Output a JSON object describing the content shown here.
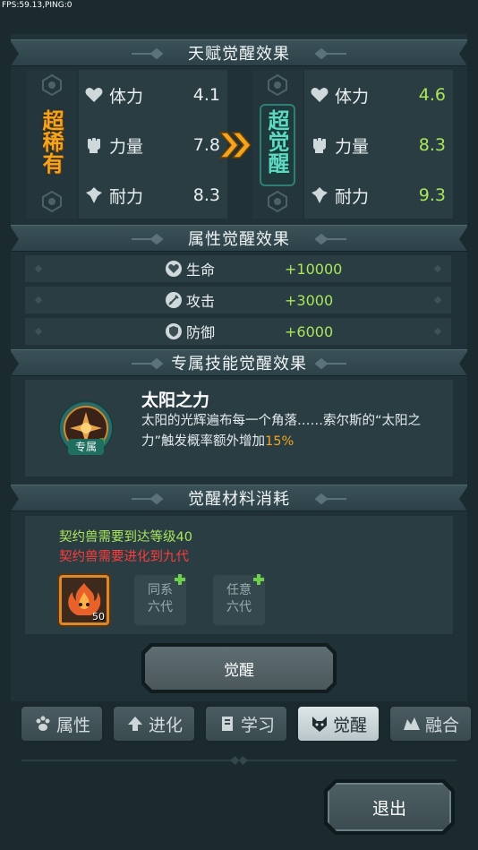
{
  "hud": {
    "fps": "FPS:59.13,PING:0"
  },
  "sections": {
    "talent": "天赋觉醒效果",
    "attr": "属性觉醒效果",
    "skill": "专属技能觉醒效果",
    "material": "觉醒材料消耗"
  },
  "talent": {
    "before": {
      "rank": "超稀有",
      "stats": [
        {
          "name": "体力",
          "value": "4.1",
          "icon": "heart-icon"
        },
        {
          "name": "力量",
          "value": "7.8",
          "icon": "fist-icon"
        },
        {
          "name": "耐力",
          "value": "8.3",
          "icon": "shield-cross-icon"
        }
      ]
    },
    "after": {
      "rank": "超觉醒",
      "stats": [
        {
          "name": "体力",
          "value": "4.6",
          "icon": "heart-icon"
        },
        {
          "name": "力量",
          "value": "8.3",
          "icon": "fist-icon"
        },
        {
          "name": "耐力",
          "value": "9.3",
          "icon": "shield-cross-icon"
        }
      ]
    }
  },
  "attributes": [
    {
      "name": "生命",
      "value": "+10000",
      "icon": "heart-shield-icon"
    },
    {
      "name": "攻击",
      "value": "+3000",
      "icon": "sword-icon"
    },
    {
      "name": "防御",
      "value": "+6000",
      "icon": "shield-icon"
    }
  ],
  "skill": {
    "name": "太阳之力",
    "badge": "专属",
    "desc_main": "太阳的光辉遍布每一个角落……索尔斯的“太阳之力”触发概率额外增加",
    "desc_highlight": "15%"
  },
  "materials": {
    "req_level": "契约兽需要到达等级40",
    "req_evolve": "契约兽需要进化到九代",
    "slots": [
      {
        "type": "item",
        "count": "50",
        "icon": "flame-beast-icon"
      },
      {
        "type": "empty",
        "line1": "同系",
        "line2": "六代"
      },
      {
        "type": "empty",
        "line1": "任意",
        "line2": "六代"
      }
    ]
  },
  "awaken_button": "觉醒",
  "tabs": [
    {
      "label": "属性",
      "icon": "paw-icon",
      "active": false
    },
    {
      "label": "进化",
      "icon": "arrow-up-icon",
      "active": false
    },
    {
      "label": "学习",
      "icon": "book-icon",
      "active": false
    },
    {
      "label": "觉醒",
      "icon": "beast-mask-icon",
      "active": true
    },
    {
      "label": "融合",
      "icon": "fusion-icon",
      "active": false
    }
  ],
  "exit_button": "退出",
  "colors": {
    "gold": "#f3a51f",
    "teal": "#4ec9b3",
    "green": "#a8e65a",
    "red": "#ff3a3a",
    "accent_orange": "#f3a51f"
  }
}
